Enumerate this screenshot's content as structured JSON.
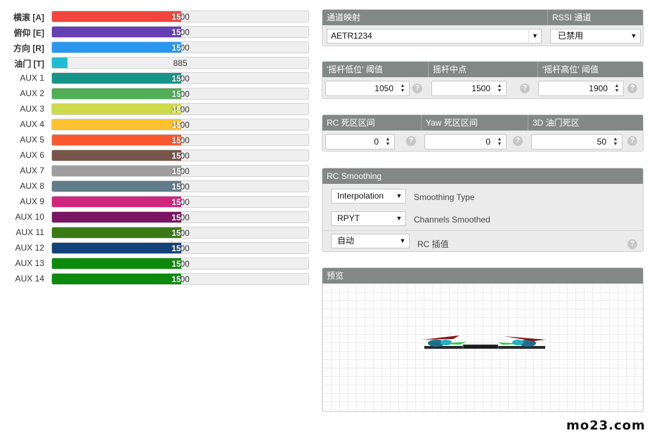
{
  "channels": [
    {
      "label": "横滚 [A]",
      "value": "1500",
      "color": "#f1453d",
      "level": 0.5
    },
    {
      "label": "俯仰 [E]",
      "value": "1500",
      "color": "#673fb4",
      "level": 0.5
    },
    {
      "label": "方向 [R]",
      "value": "1500",
      "color": "#2b98f0",
      "level": 0.5
    },
    {
      "label": "油门 [T]",
      "value": "885",
      "color": "#1fbcd2",
      "level": 0.06
    },
    {
      "label": "AUX 1",
      "value": "1500",
      "color": "#159588",
      "level": 0.5
    },
    {
      "label": "AUX 2",
      "value": "1500",
      "color": "#50ae55",
      "level": 0.5
    },
    {
      "label": "AUX 3",
      "value": "1500",
      "color": "#cdda49",
      "level": 0.5
    },
    {
      "label": "AUX 4",
      "value": "1500",
      "color": "#fdc02f",
      "level": 0.5
    },
    {
      "label": "AUX 5",
      "value": "1500",
      "color": "#fc5830",
      "level": 0.5
    },
    {
      "label": "AUX 6",
      "value": "1500",
      "color": "#785549",
      "level": 0.5
    },
    {
      "label": "AUX 7",
      "value": "1500",
      "color": "#9e9e9e",
      "level": 0.5
    },
    {
      "label": "AUX 8",
      "value": "1500",
      "color": "#617d8a",
      "level": 0.5
    },
    {
      "label": "AUX 9",
      "value": "1500",
      "color": "#cf267d",
      "level": 0.5
    },
    {
      "label": "AUX 10",
      "value": "1500",
      "color": "#7a1464",
      "level": 0.5
    },
    {
      "label": "AUX 11",
      "value": "1500",
      "color": "#3a7a14",
      "level": 0.5
    },
    {
      "label": "AUX 12",
      "value": "1500",
      "color": "#14427a",
      "level": 0.5
    },
    {
      "label": "AUX 13",
      "value": "1500",
      "color": "#0d8a0d",
      "level": 0.5
    },
    {
      "label": "AUX 14",
      "value": "1500",
      "color": "#0d8a0d",
      "level": 0.5
    }
  ],
  "channel_map": {
    "header": "通道映射",
    "value": "AETR1234",
    "rssi_header": "RSSI 通道",
    "rssi_value": "已禁用"
  },
  "stick": {
    "low_header": "'摇杆低位' 阈值",
    "low_value": "1050",
    "center_header": "摇杆中点",
    "center_value": "1500",
    "high_header": "'摇杆高位' 阈值",
    "high_value": "1900"
  },
  "deadband": {
    "rc_header": "RC 死区区间",
    "rc_value": "0",
    "yaw_header": "Yaw 死区区间",
    "yaw_value": "0",
    "throttle_header": "3D 油门死区",
    "throttle_value": "50"
  },
  "smoothing": {
    "header": "RC Smoothing",
    "type_value": "Interpolation",
    "type_label": "Smoothing Type",
    "channels_value": "RPYT",
    "channels_label": "Channels Smoothed",
    "interp_value": "自动",
    "interp_label": "RC 插值"
  },
  "preview": {
    "header": "预览"
  },
  "help_glyph": "?",
  "watermark": "mo23.com"
}
